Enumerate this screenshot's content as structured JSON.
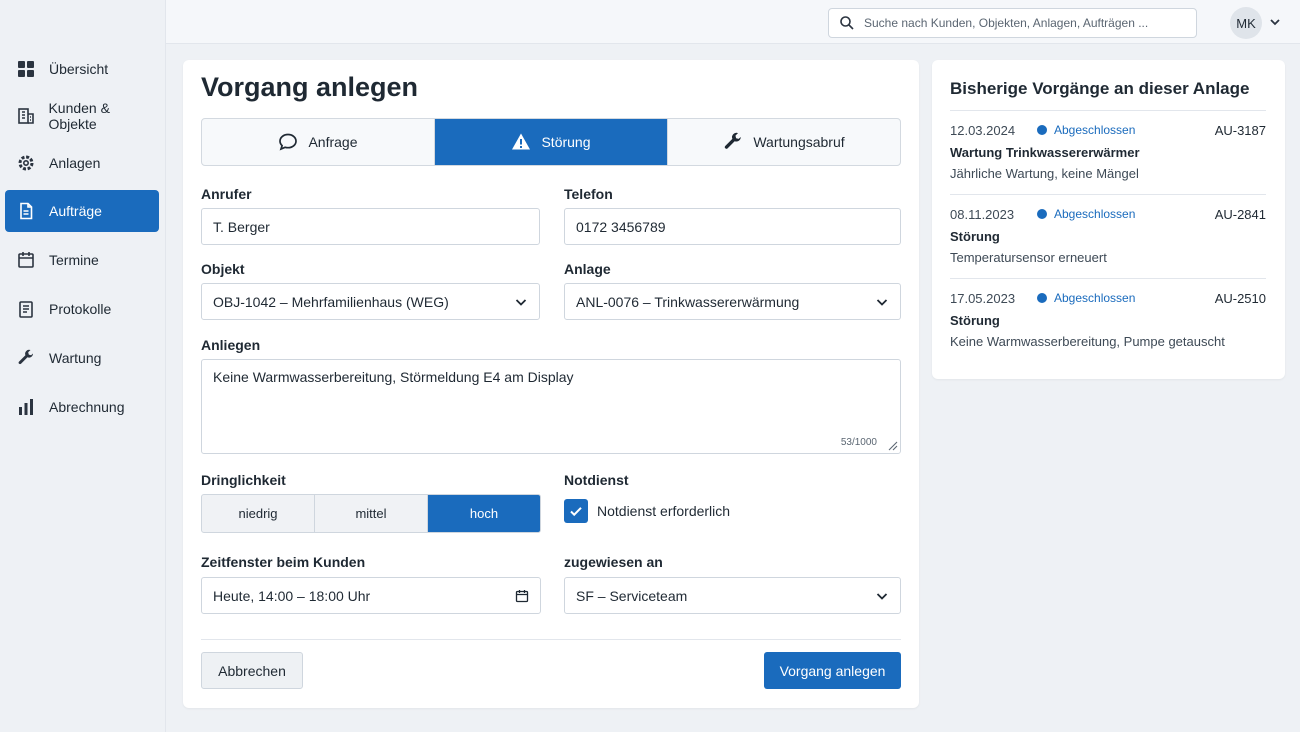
{
  "sidebar": {
    "items": [
      {
        "label": "Übersicht",
        "icon": "grid-icon"
      },
      {
        "label": "Kunden & Objekte",
        "icon": "building-icon"
      },
      {
        "label": "Anlagen",
        "icon": "gear-icon"
      },
      {
        "label": "Aufträge",
        "icon": "document-icon",
        "active": true
      },
      {
        "label": "Termine",
        "icon": "calendar-icon"
      },
      {
        "label": "Protokolle",
        "icon": "clipboard-icon"
      },
      {
        "label": "Wartung",
        "icon": "wrench-icon"
      },
      {
        "label": "Abrechnung",
        "icon": "bar-chart-icon"
      }
    ]
  },
  "topbar": {
    "search_placeholder": "Suche nach Kunden, Objekten, Anlagen, Aufträgen ...",
    "user_initials": "MK"
  },
  "form": {
    "title": "Vorgang anlegen",
    "types": [
      {
        "label": "Anfrage",
        "icon": "chat-bubble-icon"
      },
      {
        "label": "Störung",
        "icon": "warning-icon",
        "active": true
      },
      {
        "label": "Wartungsabruf",
        "icon": "wrench-icon"
      }
    ],
    "caller_label": "Anrufer",
    "caller_value": "T. Berger",
    "phone_label": "Telefon",
    "phone_value": "0172 3456789",
    "object_label": "Objekt",
    "object_value": "OBJ-1042 – Mehrfamilienhaus (WEG)",
    "system_label": "Anlage",
    "system_value": "ANL-0076 – Trinkwassererwärmung",
    "concern_label": "Anliegen",
    "concern_value": "Keine Warmwasserbereitung, Störmeldung E4 am Display",
    "concern_counter": "53/1000",
    "urgency_label": "Dringlichkeit",
    "urgency_options": [
      "niedrig",
      "mittel",
      "hoch"
    ],
    "urgency_selected": "hoch",
    "emergency_label": "Notdienst",
    "emergency_checkbox_label": "Notdienst erforderlich",
    "emergency_checked": true,
    "timewindow_label": "Zeitfenster beim Kunden",
    "timewindow_value": "Heute, 14:00 – 18:00 Uhr",
    "assigned_label": "zugewiesen an",
    "assigned_value": "SF – Serviceteam",
    "cancel_label": "Abbrechen",
    "submit_label": "Vorgang anlegen"
  },
  "history": {
    "title": "Bisherige Vorgänge an dieser Anlage",
    "items": [
      {
        "date": "12.03.2024",
        "status": "Abgeschlossen",
        "id": "AU-3187",
        "title": "Wartung Trinkwassererwärmer",
        "desc": "Jährliche Wartung, keine Mängel"
      },
      {
        "date": "08.11.2023",
        "status": "Abgeschlossen",
        "id": "AU-2841",
        "title": "Störung",
        "desc": "Temperatursensor erneuert"
      },
      {
        "date": "17.05.2023",
        "status": "Abgeschlossen",
        "id": "AU-2510",
        "title": "Störung",
        "desc": "Keine Warmwasserbereitung, Pumpe getauscht"
      }
    ]
  },
  "colors": {
    "accent": "#1a6bbd",
    "background": "#eef1f5"
  }
}
